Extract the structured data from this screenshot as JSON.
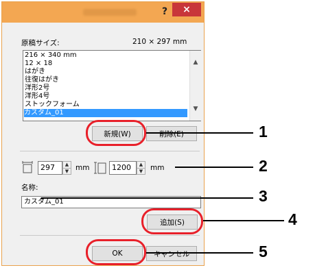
{
  "window": {
    "help_glyph": "?",
    "close_glyph": "×"
  },
  "paper_size": {
    "label": "原稿サイズ:",
    "current_value": "210 × 297 mm",
    "items": [
      "216 × 340 mm",
      "12 × 18",
      "はがき",
      "往復はがき",
      "洋形2号",
      "洋形4号",
      "ストックフォーム",
      "カスタム_01"
    ],
    "selected_index": 7
  },
  "buttons": {
    "new": "新規(W)",
    "delete": "削除(E)",
    "add": "追加(S)",
    "ok": "OK",
    "cancel": "キャンセル"
  },
  "dimensions": {
    "width_value": "297",
    "width_unit": "mm",
    "height_value": "1200",
    "height_unit": "mm"
  },
  "name": {
    "label": "名称:",
    "value": "カスタム_01"
  },
  "callout_numbers": [
    "1",
    "2",
    "3",
    "4",
    "5"
  ],
  "colors": {
    "titlebar": "#f3a752",
    "close": "#c8363a",
    "selection": "#3399ff",
    "callout": "#e8202a"
  }
}
